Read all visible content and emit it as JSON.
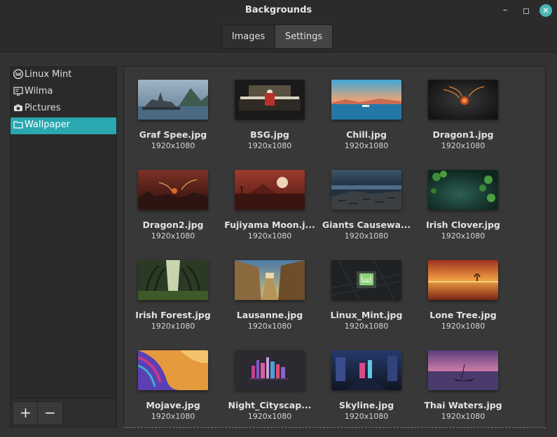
{
  "window": {
    "title": "Backgrounds"
  },
  "tabs": [
    {
      "label": "Images"
    },
    {
      "label": "Settings"
    }
  ],
  "sidebar": {
    "items": [
      {
        "label": "Linux Mint",
        "icon": "mint-logo-icon"
      },
      {
        "label": "Wilma",
        "icon": "screen-icon"
      },
      {
        "label": "Pictures",
        "icon": "camera-icon"
      },
      {
        "label": "Wallpaper",
        "icon": "folder-icon",
        "selected": true
      }
    ]
  },
  "buttons": {
    "add": "+",
    "remove": "−"
  },
  "images": [
    {
      "name": "Graf Spee.jpg",
      "res": "1920x1080"
    },
    {
      "name": "BSG.jpg",
      "res": "1920x1080"
    },
    {
      "name": "Chill.jpg",
      "res": "1920x1080"
    },
    {
      "name": "Dragon1.jpg",
      "res": "1920x1080"
    },
    {
      "name": "Dragon2.jpg",
      "res": "1920x1080"
    },
    {
      "name": "Fujiyama Moon.j...",
      "res": "1920x1080"
    },
    {
      "name": "Giants Causewa...",
      "res": "1920x1080"
    },
    {
      "name": "Irish Clover.jpg",
      "res": "1920x1080"
    },
    {
      "name": "Irish Forest.jpg",
      "res": "1920x1080"
    },
    {
      "name": "Lausanne.jpg",
      "res": "1920x1080"
    },
    {
      "name": "Linux_Mint.jpg",
      "res": "1920x1080"
    },
    {
      "name": "Lone Tree.jpg",
      "res": "1920x1080"
    },
    {
      "name": "Mojave.jpg",
      "res": "1920x1080"
    },
    {
      "name": "Night_Cityscap...",
      "res": "1920x1080"
    },
    {
      "name": "Skyline.jpg",
      "res": "1920x1080"
    },
    {
      "name": "Thai Waters.jpg",
      "res": "1920x1080"
    }
  ],
  "colors": {
    "accent": "#2aa7b0",
    "close_button": "#4db5b5"
  }
}
